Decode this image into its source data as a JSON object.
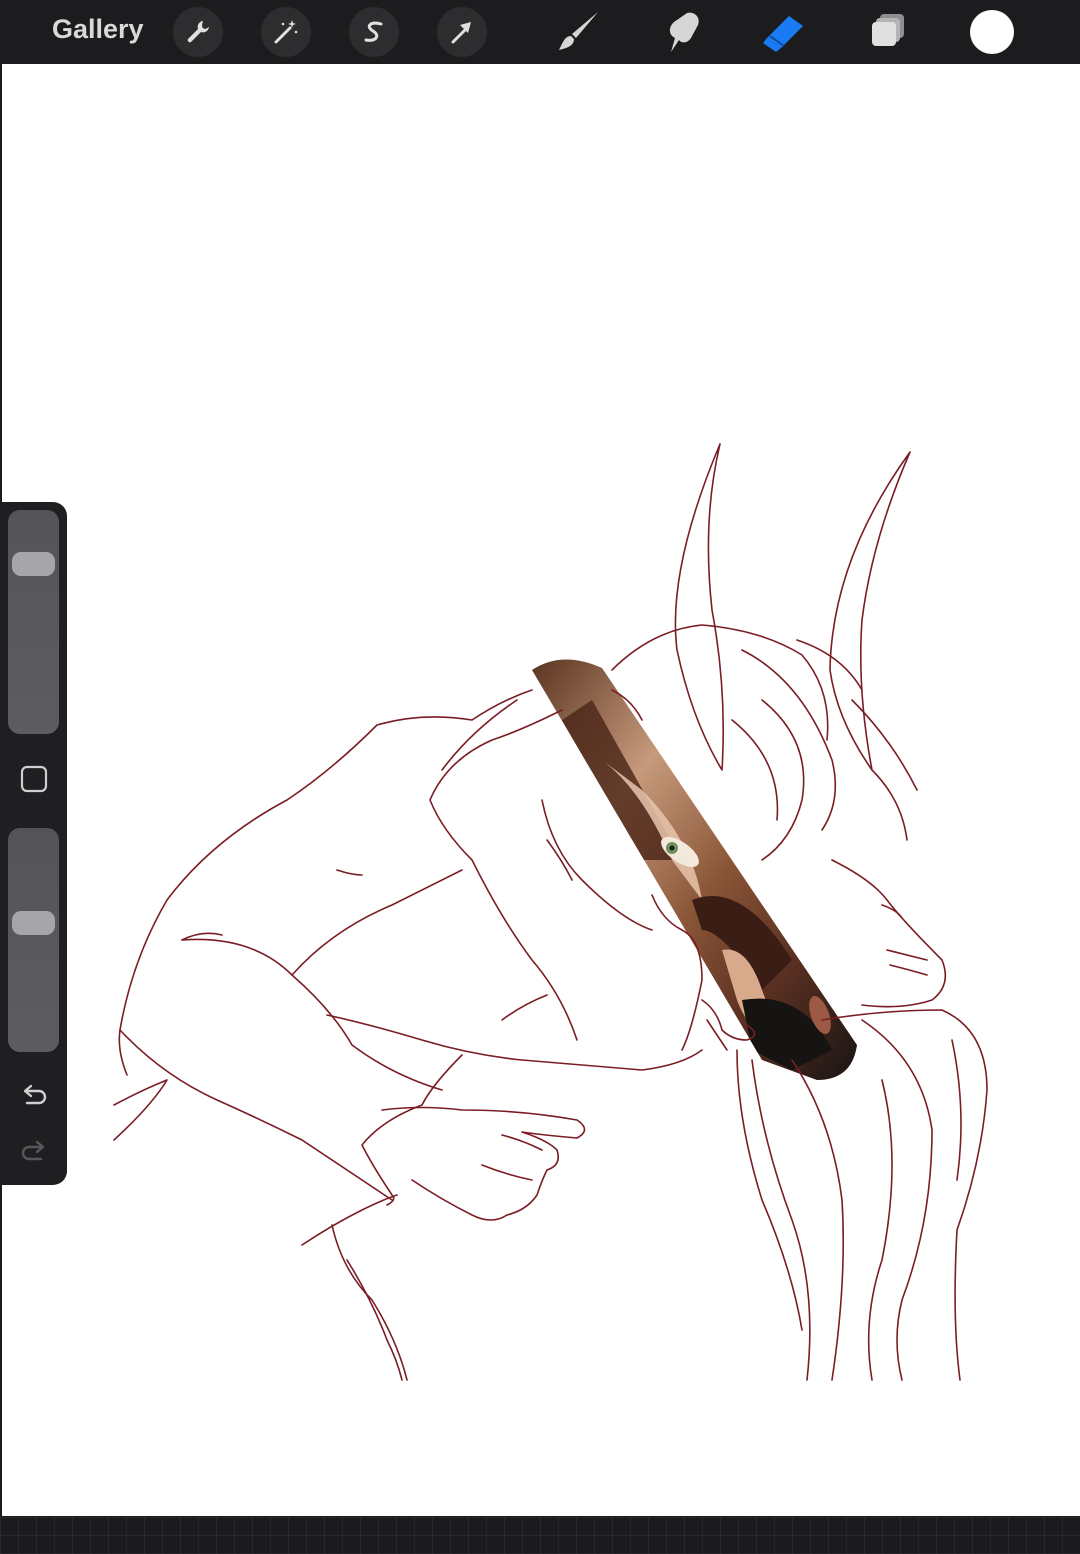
{
  "topbar": {
    "gallery_label": "Gallery",
    "actions": [
      "wrench-icon",
      "magic-wand-icon",
      "selection-s-icon",
      "transform-arrow-icon"
    ],
    "tools": [
      "brush-icon",
      "smudge-icon",
      "eraser-icon",
      "layers-icon"
    ],
    "active_tool": "eraser",
    "current_color": "#ffffff"
  },
  "sidebar": {
    "brush_size_level": 0.12,
    "opacity_level": 0.39,
    "controls": [
      "modify-square-icon",
      "undo-icon",
      "redo-icon"
    ]
  },
  "colors": {
    "toolbar_bg": "#1c1c1e",
    "accent_active": "#1a7cf5",
    "lineart": "#7a1d24",
    "skin": "#8a5537"
  }
}
